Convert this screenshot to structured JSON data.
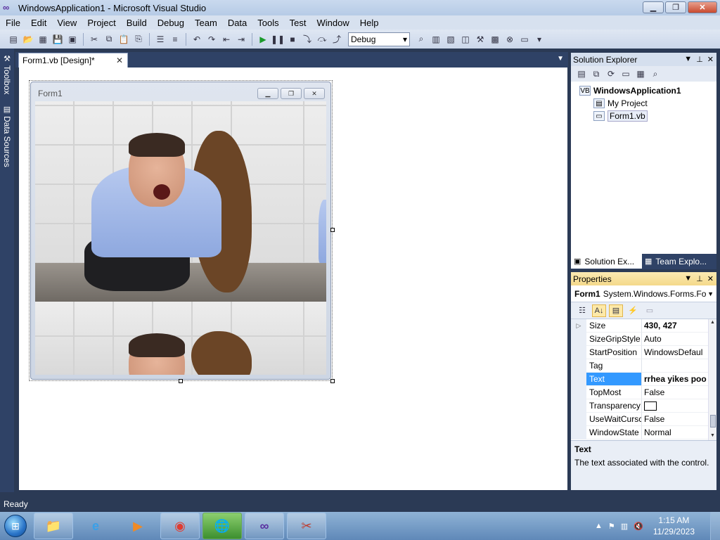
{
  "window": {
    "title": "WindowsApplication1 - Microsoft Visual Studio"
  },
  "menu": [
    "File",
    "Edit",
    "View",
    "Project",
    "Build",
    "Debug",
    "Team",
    "Data",
    "Tools",
    "Test",
    "Window",
    "Help"
  ],
  "toolbar": {
    "config": "Debug"
  },
  "left_dock": {
    "toolbox": "Toolbox",
    "data_sources": "Data Sources"
  },
  "document": {
    "tab": "Form1.vb [Design]*"
  },
  "form": {
    "title": "Form1"
  },
  "solution_explorer": {
    "title": "Solution Explorer",
    "solution": "WindowsApplication1",
    "items": [
      "My Project",
      "Form1.vb"
    ],
    "tabs": [
      "Solution Ex...",
      "Team Explo..."
    ]
  },
  "properties": {
    "title": "Properties",
    "object_name": "Form1",
    "object_type": "System.Windows.Forms.Fo",
    "rows": [
      {
        "name": "Size",
        "value": "430, 427"
      },
      {
        "name": "SizeGripStyle",
        "value": "Auto"
      },
      {
        "name": "StartPosition",
        "value": "WindowsDefaul"
      },
      {
        "name": "Tag",
        "value": ""
      },
      {
        "name": "Text",
        "value": "rrhea yikes poo"
      },
      {
        "name": "TopMost",
        "value": "False"
      },
      {
        "name": "Transparency",
        "value": ""
      },
      {
        "name": "UseWaitCursc",
        "value": "False"
      },
      {
        "name": "WindowState",
        "value": "Normal"
      }
    ],
    "description_title": "Text",
    "description": "The text associated with the control."
  },
  "status": {
    "text": "Ready"
  },
  "taskbar": {
    "time": "1:15 AM",
    "date": "11/29/2023"
  },
  "colors": {
    "selection": "#3399ff",
    "dock": "#2f4266",
    "taskbar": "#5f88b8"
  }
}
